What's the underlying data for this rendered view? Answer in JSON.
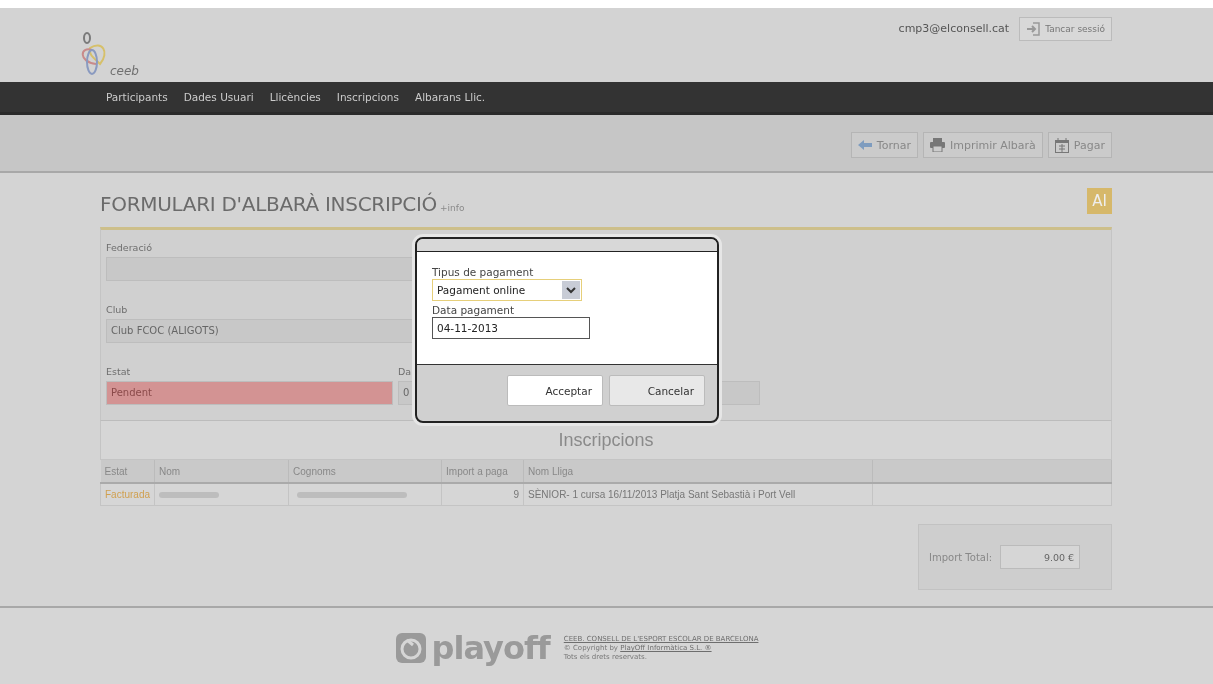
{
  "header": {
    "logo_text": "ceeb",
    "user_email": "cmp3@elconsell.cat",
    "logout_button": "Tancar sessió"
  },
  "nav": {
    "items": [
      "Participants",
      "Dades Usuari",
      "Llicències",
      "Inscripcions",
      "Albarans Llic."
    ]
  },
  "toolbar": {
    "buttons": [
      {
        "label": "Tornar",
        "kind": "back"
      },
      {
        "label": "Imprimir Albarà",
        "kind": "print"
      },
      {
        "label": "Pagar",
        "kind": "calendar"
      }
    ]
  },
  "page": {
    "title": "FORMULARI D'ALBARÀ INSCRIPCIÓ",
    "info_link": "+info",
    "badge": "AI"
  },
  "form": {
    "fields": [
      {
        "label": "Federació",
        "kind": "text"
      },
      {
        "label": "Club",
        "value": "Club FCOC (ALIGOTS)",
        "kind": "text"
      },
      {
        "label": "Estat",
        "value": "Pendent",
        "kind": "status"
      },
      {
        "label": "Da",
        "value": "0",
        "kind": "text"
      }
    ]
  },
  "section_title": "Inscripcions",
  "table": {
    "columns": [
      "Estat",
      "Nom",
      "Cognoms",
      "Import a paga",
      "Nom Lliga",
      ""
    ],
    "rows": [
      {
        "cells": [
          {
            "kind": "status",
            "text": "Facturada"
          },
          {
            "kind": "redacted"
          },
          {
            "kind": "redacted"
          },
          {
            "kind": "number",
            "text": "9"
          },
          {
            "kind": "text",
            "text": "SÈNIOR- 1 cursa 16/11/2013 Platja Sant Sebastià i Port Vell"
          },
          {
            "kind": "empty"
          }
        ]
      }
    ]
  },
  "total": {
    "label": "Import Total:",
    "value": "9.00 €"
  },
  "modal": {
    "payment_type": {
      "label": "Tipus de pagament",
      "value": "Pagament online"
    },
    "payment_date": {
      "label": "Data pagament",
      "value": "04-11-2013"
    },
    "buttons": [
      {
        "label": "Acceptar",
        "kind": "primary"
      },
      {
        "label": "Cancelar",
        "kind": "secondary"
      }
    ]
  },
  "footer": {
    "logo_text": "playoff",
    "lines": [
      [
        {
          "text": "CEEB. CONSELL DE L'ESPORT ESCOLAR DE BARCELONA",
          "link": true
        }
      ],
      [
        {
          "text": "© Copyright by ",
          "link": false
        },
        {
          "text": "PlayOff Informàtica S.L. ®",
          "link": true
        }
      ],
      [
        {
          "text": "Tots els drets reservats.",
          "link": false
        }
      ]
    ]
  }
}
